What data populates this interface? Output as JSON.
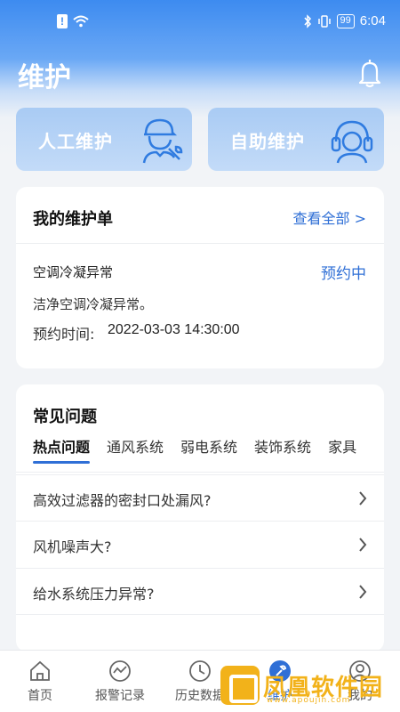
{
  "status_bar": {
    "time": "6:04",
    "battery": "99"
  },
  "header": {
    "title": "维护"
  },
  "services": [
    {
      "label": "人工维护",
      "icon": "worker-wrench-icon"
    },
    {
      "label": "自助维护",
      "icon": "headset-agent-icon"
    }
  ],
  "orders": {
    "title": "我的维护单",
    "view_all": "查看全部 >",
    "item": {
      "name": "空调冷凝异常",
      "status": "预约中",
      "description": "洁净空调冷凝异常。",
      "time_label": "预约时间:",
      "time_value": "2022-03-03 14:30:00"
    }
  },
  "faq": {
    "title": "常见问题",
    "tabs": [
      "热点问题",
      "通风系统",
      "弱电系统",
      "装饰系统",
      "家具"
    ],
    "active_tab": 0,
    "questions": [
      "高效过滤器的密封口处漏风?",
      "风机噪声大?",
      "给水系统压力异常?"
    ]
  },
  "tabbar": {
    "items": [
      {
        "label": "首页",
        "icon": "home-icon"
      },
      {
        "label": "报警记录",
        "icon": "alarm-chart-icon"
      },
      {
        "label": "历史数据",
        "icon": "clock-icon"
      },
      {
        "label": "维护",
        "icon": "wrench-icon"
      },
      {
        "label": "我的",
        "icon": "user-icon"
      }
    ],
    "active": 3
  },
  "watermark": {
    "text": "凤凰软件园",
    "url": "www.apoujin.com"
  },
  "colors": {
    "primary": "#3d8bf0",
    "accent": "#2f6fd6"
  }
}
